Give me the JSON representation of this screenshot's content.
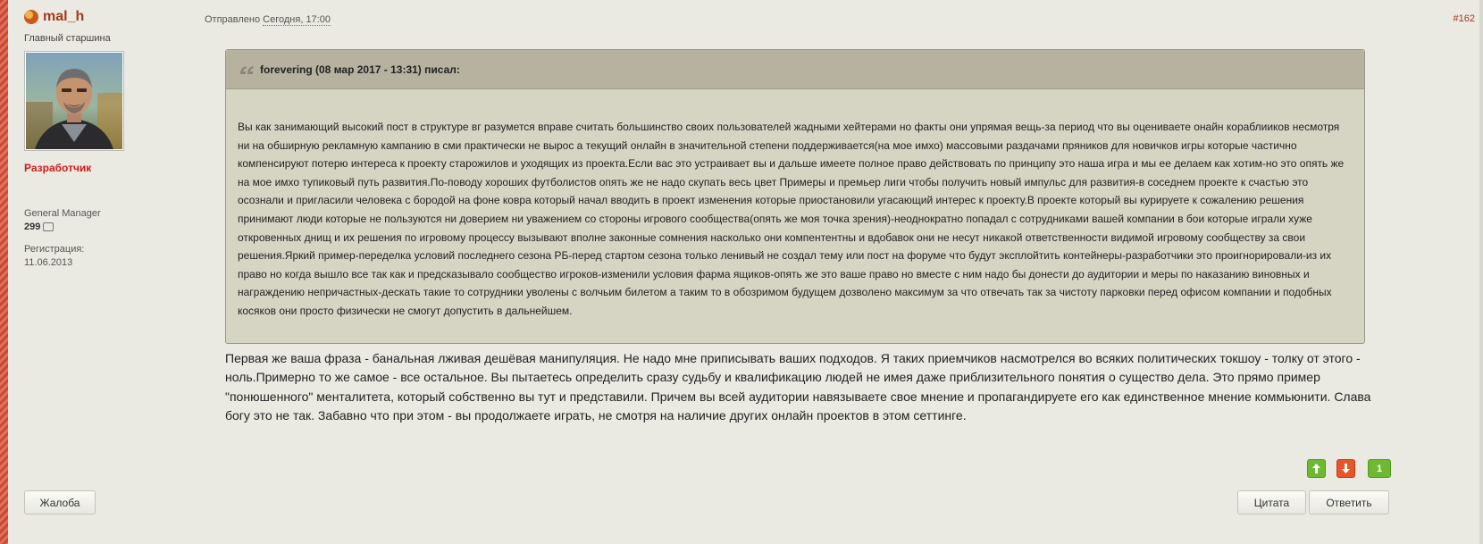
{
  "author": {
    "name": "mal_h",
    "rank": "Главный старшина",
    "group": "Разработчик",
    "title": "General Manager",
    "post_count": "299",
    "registration_label": "Регистрация:",
    "registration_date": "11.06.2013"
  },
  "post": {
    "sent_label": "Отправлено",
    "sent_date": "Сегодня, 17:00",
    "number": "#162",
    "quote_header": "forevering (08 мар 2017 - 13:31) писал:",
    "quote_text": "Вы как занимающий высокий пост в структуре вг разумется вправе считать большинство своих пользователей жадными хейтерами но факты они упрямая вещь-за период что вы оцениваете онайн кораблииков несмотря ни на обширную рекламную кампанию в сми практически не вырос а текущий онлайн в значительной степени поддерживается(на мое имхо) массовыми раздачами пряников для новичков игры которые частично компенсируют потерю интереса к проекту старожилов и уходящих из проекта.Если вас это устраивает вы и дальше имеете полное право действовать по принципу это наша игра и мы ее делаем как хотим-но это опять же на мое имхо тупиковый путь развития.По-поводу хороших футболистов опять же не надо скупать весь цвет Примеры и премьер лиги чтобы получить новый импульс для развития-в соседнем проекте к счастью это осознали и пригласили человека с бородой на фоне ковра который начал вводить в проект изменения которые приостановили угасающий интерес к проекту.В проекте который вы курируете к сожалению решения принимают люди которые не пользуются ни доверием ни уважением со стороны игрового сообщества(опять же моя точка зрения)-неоднократно попадал с сотрудниками вашей компании в бои которые играли хуже откровенных днищ и их решения по игровому процессу вызывают вполне законные сомнения насколько они компентентны и вдобавок они не несут никакой ответственности видимой игровому сообществу за свои решения.Яркий пример-переделка условий последнего сезона РБ-перед стартом сезона только ленивый не создал тему или пост на форуме что будут эксплойтить контейнеры-разработчики это проигнорировали-из их право но когда вышло все так как и предсказывало сообщество игроков-изменили условия фарма ящиков-опять же это ваше право но вместе с ним надо бы донести до аудитории и меры по наказанию виновных и награждению непричастных-дескать такие то сотрудники уволены с волчьим билетом а таким то в обозримом будущем дозволено максимум за что отвечать так за чистоту парковки перед  офисом компании и подобных косяков они просто физически не смогут допустить в дальнейшем.",
    "body": "Первая же ваша фраза - банальная лживая дешёвая манипуляция. Не надо мне приписывать ваших подходов. Я таких приемчиков насмотрелся во всяких политических токшоу - толку от этого - ноль.Примерно то же самое - все остальное. Вы пытаетесь определить сразу судьбу и квалификацию людей не имея даже приблизительного понятия о существо дела. Это прямо пример \"понюшенного\" менталитета, который собственно вы тут и представили. Причем вы всей аудитории навязываете свое мнение и пропагандируете его как единственное мнение коммьюнити. Слава богу это не так. Забавно что при этом - вы продолжаете играть, не смотря на наличие других онлайн проектов в этом сеттинге."
  },
  "votes": {
    "up_icon": "arrow-up-icon",
    "down_icon": "arrow-down-icon",
    "score": "1"
  },
  "buttons": {
    "report": "Жалоба",
    "quote": "Цитата",
    "reply": "Ответить"
  },
  "colors": {
    "author_name": "#a23a1e",
    "group": "#cc1d1d",
    "vote_up": "#6fb832",
    "vote_down": "#e5562a",
    "quote_bg": "#d6d4c3",
    "quote_header_bg": "#b6b29f"
  }
}
